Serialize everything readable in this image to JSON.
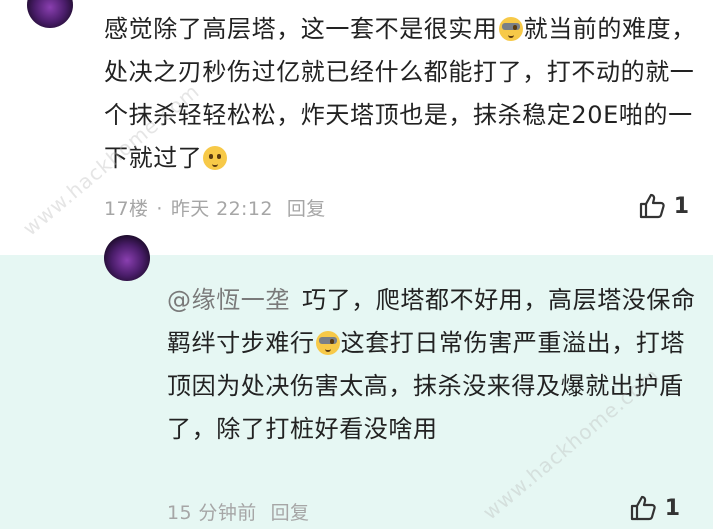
{
  "comment": {
    "text_parts": [
      "感觉除了高层塔，这一套不是很实用",
      "就当前的难度，处决之刃秒伤过亿就已经什么都能打了，打不动的就一个抹杀轻轻松松，炸天塔顶也是，抹杀稳定20E啪的一下就过了"
    ],
    "floor": "17楼",
    "separator": "·",
    "time": "昨天 22:12",
    "reply_label": "回复",
    "likes": "1"
  },
  "reply": {
    "mention": "@缘恆一垄",
    "text_parts": [
      "巧了，爬塔都不好用，高层塔没保命羁绊寸步难行",
      "这套打日常伤害严重溢出，打塔顶因为处决伤害太高，抹杀没来得及爆就出护盾了，除了打桩好看没啥用"
    ],
    "time": "15 分钟前",
    "reply_label": "回复",
    "likes": "1"
  },
  "watermark": {
    "text": "www.hackhome.com"
  },
  "icons": {
    "like": "thumbs-up-icon",
    "emoji_cool": "sunglasses-face-icon",
    "emoji_smile": "smiling-face-icon"
  }
}
